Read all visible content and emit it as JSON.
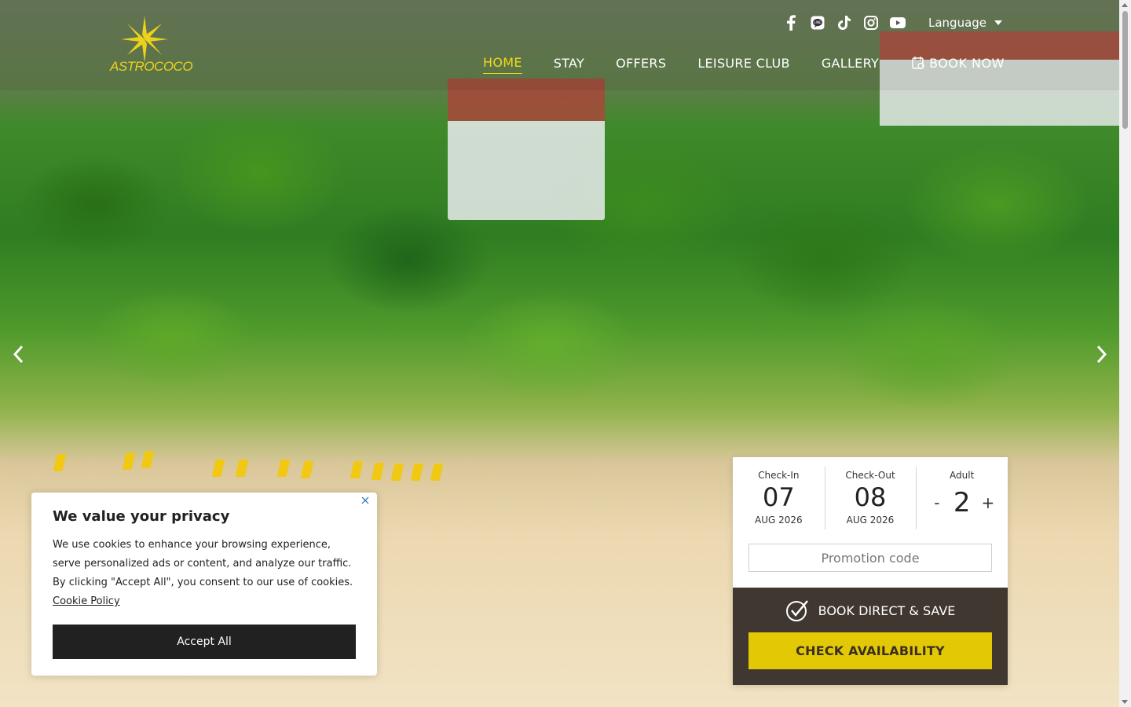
{
  "brand": {
    "logo_text": "ASTROCOCO",
    "accent": "#f2d81c"
  },
  "social": [
    {
      "name": "facebook-icon"
    },
    {
      "name": "line-icon"
    },
    {
      "name": "tiktok-icon"
    },
    {
      "name": "instagram-icon"
    },
    {
      "name": "youtube-icon"
    }
  ],
  "language": {
    "label": "Language"
  },
  "nav": {
    "home": "HOME",
    "stay": "STAY",
    "offers": "OFFERS",
    "leisure": "LEISURE CLUB",
    "gallery": "GALLERY",
    "book": "BOOK NOW"
  },
  "booking": {
    "checkin": {
      "label": "Check-In",
      "day": "07",
      "month": "AUG 2026"
    },
    "checkout": {
      "label": "Check-Out",
      "day": "08",
      "month": "AUG 2026"
    },
    "adult": {
      "label": "Adult",
      "minus": "-",
      "count": "2",
      "plus": "+"
    },
    "promo_placeholder": "Promotion code",
    "save_label": "BOOK DIRECT & SAVE",
    "check_label": "CHECK AVAILABILITY",
    "colors": {
      "panel": "#3f3730",
      "button": "#e2c805"
    }
  },
  "cookie": {
    "title": "We value your privacy",
    "body": "We use cookies to enhance your browsing experience, serve personalized ads or content, and analyze our traffic. By clicking \"Accept All\", you consent to our use of cookies.",
    "policy_link": "Cookie Policy",
    "accept_label": "Accept All"
  }
}
